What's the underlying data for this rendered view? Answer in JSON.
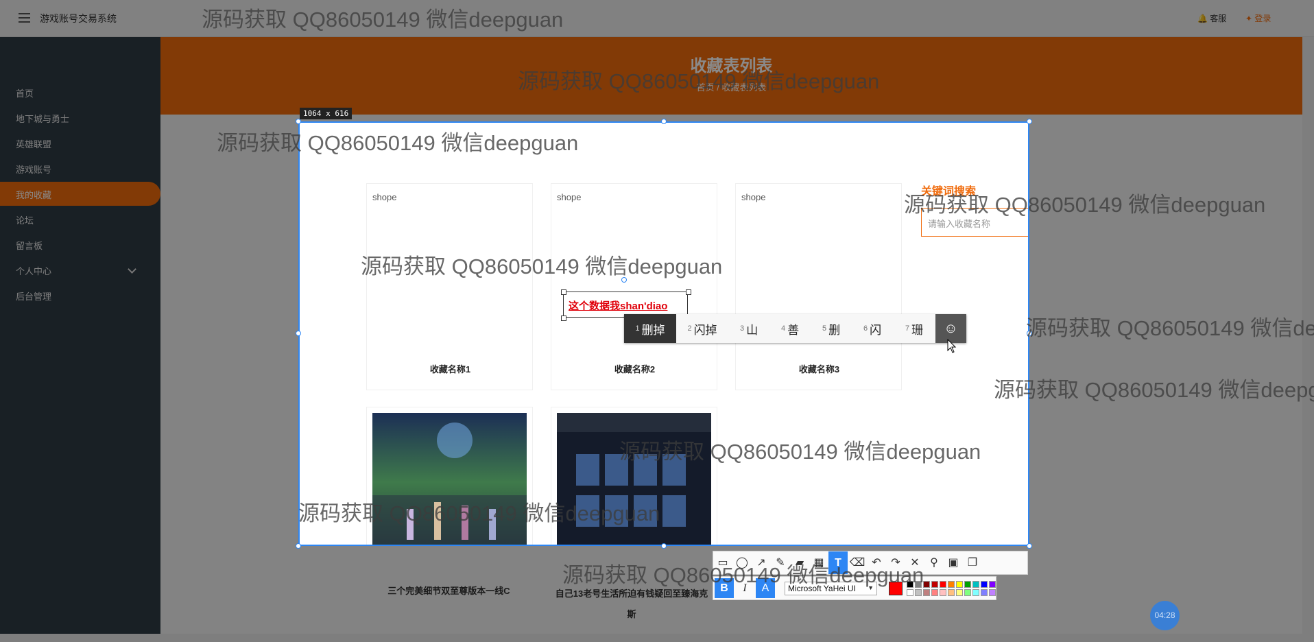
{
  "app": {
    "title": "游戏账号交易系统",
    "customer_service": "客服",
    "login": "登录"
  },
  "sidebar": {
    "items": [
      {
        "label": "首页"
      },
      {
        "label": "地下城与勇士"
      },
      {
        "label": "英雄联盟"
      },
      {
        "label": "游戏账号"
      },
      {
        "label": "我的收藏"
      },
      {
        "label": "论坛"
      },
      {
        "label": "留言板"
      },
      {
        "label": "个人中心"
      },
      {
        "label": "后台管理"
      }
    ]
  },
  "header": {
    "title": "收藏表列表",
    "breadcrumb": "首页 / 收藏表列表"
  },
  "capture": {
    "size_label": "1064 x 616"
  },
  "search": {
    "title": "关键词搜索",
    "placeholder": "请输入收藏名称"
  },
  "cards": [
    {
      "alt": "shope",
      "name": "收藏名称1"
    },
    {
      "alt": "shope",
      "name": "收藏名称2"
    },
    {
      "alt": "shope",
      "name": "收藏名称3"
    },
    {
      "name": "三个完美细节双至尊版本一线C"
    },
    {
      "name": "自己13老号生活所迫有钱疑回至臻海克斯"
    }
  ],
  "annotation": {
    "text": "这个数据我shan'diao"
  },
  "ime": {
    "candidates": [
      {
        "index": "1",
        "text": "删掉"
      },
      {
        "index": "2",
        "text": "闪掉"
      },
      {
        "index": "3",
        "text": "山"
      },
      {
        "index": "4",
        "text": "善"
      },
      {
        "index": "5",
        "text": "删"
      },
      {
        "index": "6",
        "text": "闪"
      },
      {
        "index": "7",
        "text": "珊"
      }
    ],
    "emoji": "☺"
  },
  "editor": {
    "font_name": "Microsoft YaHei UI",
    "bold": "B",
    "italic": "I",
    "text_effect": "A",
    "current_color": "#ff0000",
    "palette": [
      "#000000",
      "#808080",
      "#800000",
      "#c00000",
      "#ff0000",
      "#ff8000",
      "#ffff00",
      "#00a000",
      "#00c0c0",
      "#0000ff",
      "#8000ff",
      "#ffffff",
      "#c0c0c0",
      "#c08080",
      "#ff8080",
      "#ffc0c0",
      "#ffc080",
      "#ffff80",
      "#80ff80",
      "#80ffff",
      "#8080ff",
      "#c080ff"
    ]
  },
  "timer": "04:28",
  "watermark": "源码获取 QQ86050149 微信deepguan"
}
